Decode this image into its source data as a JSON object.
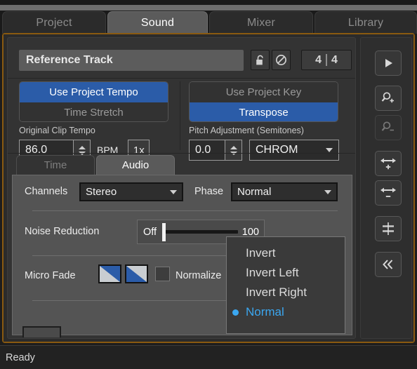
{
  "window": {
    "status_text": "Ready",
    "accent_blue": "#2b5ca8",
    "highlight_blue": "#3ba7f0",
    "focus_border": "#8a5a10"
  },
  "tabs": [
    {
      "label": "Project",
      "active": false
    },
    {
      "label": "Sound",
      "active": true
    },
    {
      "label": "Mixer",
      "active": false
    },
    {
      "label": "Library",
      "active": false
    }
  ],
  "track": {
    "name": "Reference Track",
    "lock_icon": "unlock-icon",
    "mute_icon": "no-entry-icon",
    "meter_numerator": "4",
    "meter_denominator": "4"
  },
  "tempo": {
    "use_project_tempo": "Use Project Tempo",
    "time_stretch": "Time Stretch",
    "label": "Original Clip Tempo",
    "value": "86.0",
    "unit": "BPM",
    "rate_button": "1x"
  },
  "key": {
    "use_project_key": "Use Project Key",
    "transpose": "Transpose",
    "label": "Pitch Adjustment (Semitones)",
    "value": "0.0",
    "mode": "CHROM"
  },
  "sub_tabs": [
    {
      "label": "Time",
      "active": false
    },
    {
      "label": "Audio",
      "active": true
    }
  ],
  "audio": {
    "channels_label": "Channels",
    "channels_value": "Stereo",
    "phase_label": "Phase",
    "phase_value": "Normal",
    "noise_reduction_label": "Noise Reduction",
    "noise_min": "Off",
    "noise_max": "100",
    "micro_fade_label": "Micro Fade",
    "normalize_label": "Normalize"
  },
  "phase_menu": {
    "items": [
      {
        "label": "Invert",
        "selected": false
      },
      {
        "label": "Invert Left",
        "selected": false
      },
      {
        "label": "Invert Right",
        "selected": false
      },
      {
        "label": "Normal",
        "selected": true
      }
    ]
  },
  "rail": [
    {
      "name": "play-icon",
      "enabled": true
    },
    {
      "name": "zoom-in-icon",
      "enabled": true
    },
    {
      "name": "zoom-out-icon",
      "enabled": false
    },
    {
      "name": "widen-plus-icon",
      "enabled": true
    },
    {
      "name": "widen-minus-icon",
      "enabled": true
    },
    {
      "name": "grid-snap-icon",
      "enabled": true
    },
    {
      "name": "collapse-icon",
      "enabled": true
    }
  ]
}
